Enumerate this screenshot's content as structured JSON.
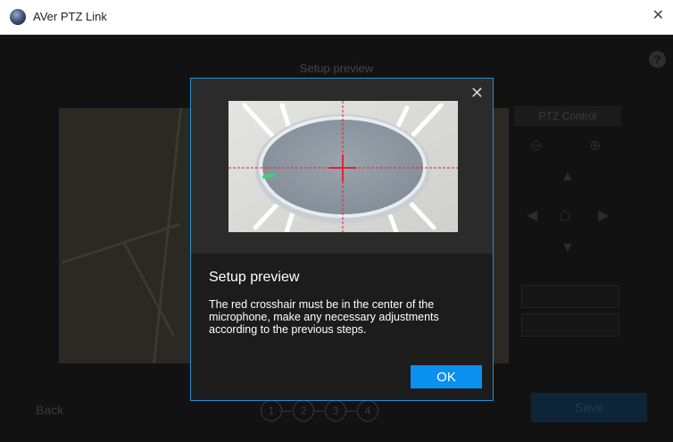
{
  "window": {
    "title": "AVer PTZ Link",
    "close_glyph": "✕"
  },
  "page": {
    "title": "Setup preview",
    "help_glyph": "?"
  },
  "ptz": {
    "title": "PTZ Control",
    "zoom_out_glyph": "⊖",
    "zoom_in_glyph": "⊕",
    "up_glyph": "▲",
    "down_glyph": "▼",
    "left_glyph": "◀",
    "right_glyph": "▶",
    "home_glyph": "⌂"
  },
  "footer": {
    "back_label": "Back",
    "save_label": "Save",
    "steps": [
      "1",
      "2",
      "3",
      "4"
    ]
  },
  "modal": {
    "close_glyph": "✕",
    "heading": "Setup preview",
    "body": "The red crosshair must be in the center of the microphone, make any necessary adjustments according to the previous steps.",
    "ok_label": "OK"
  },
  "colors": {
    "accent": "#0a90ee",
    "modal_border": "#1e90d8",
    "crosshair": "#e8202a",
    "background": "#121212"
  }
}
